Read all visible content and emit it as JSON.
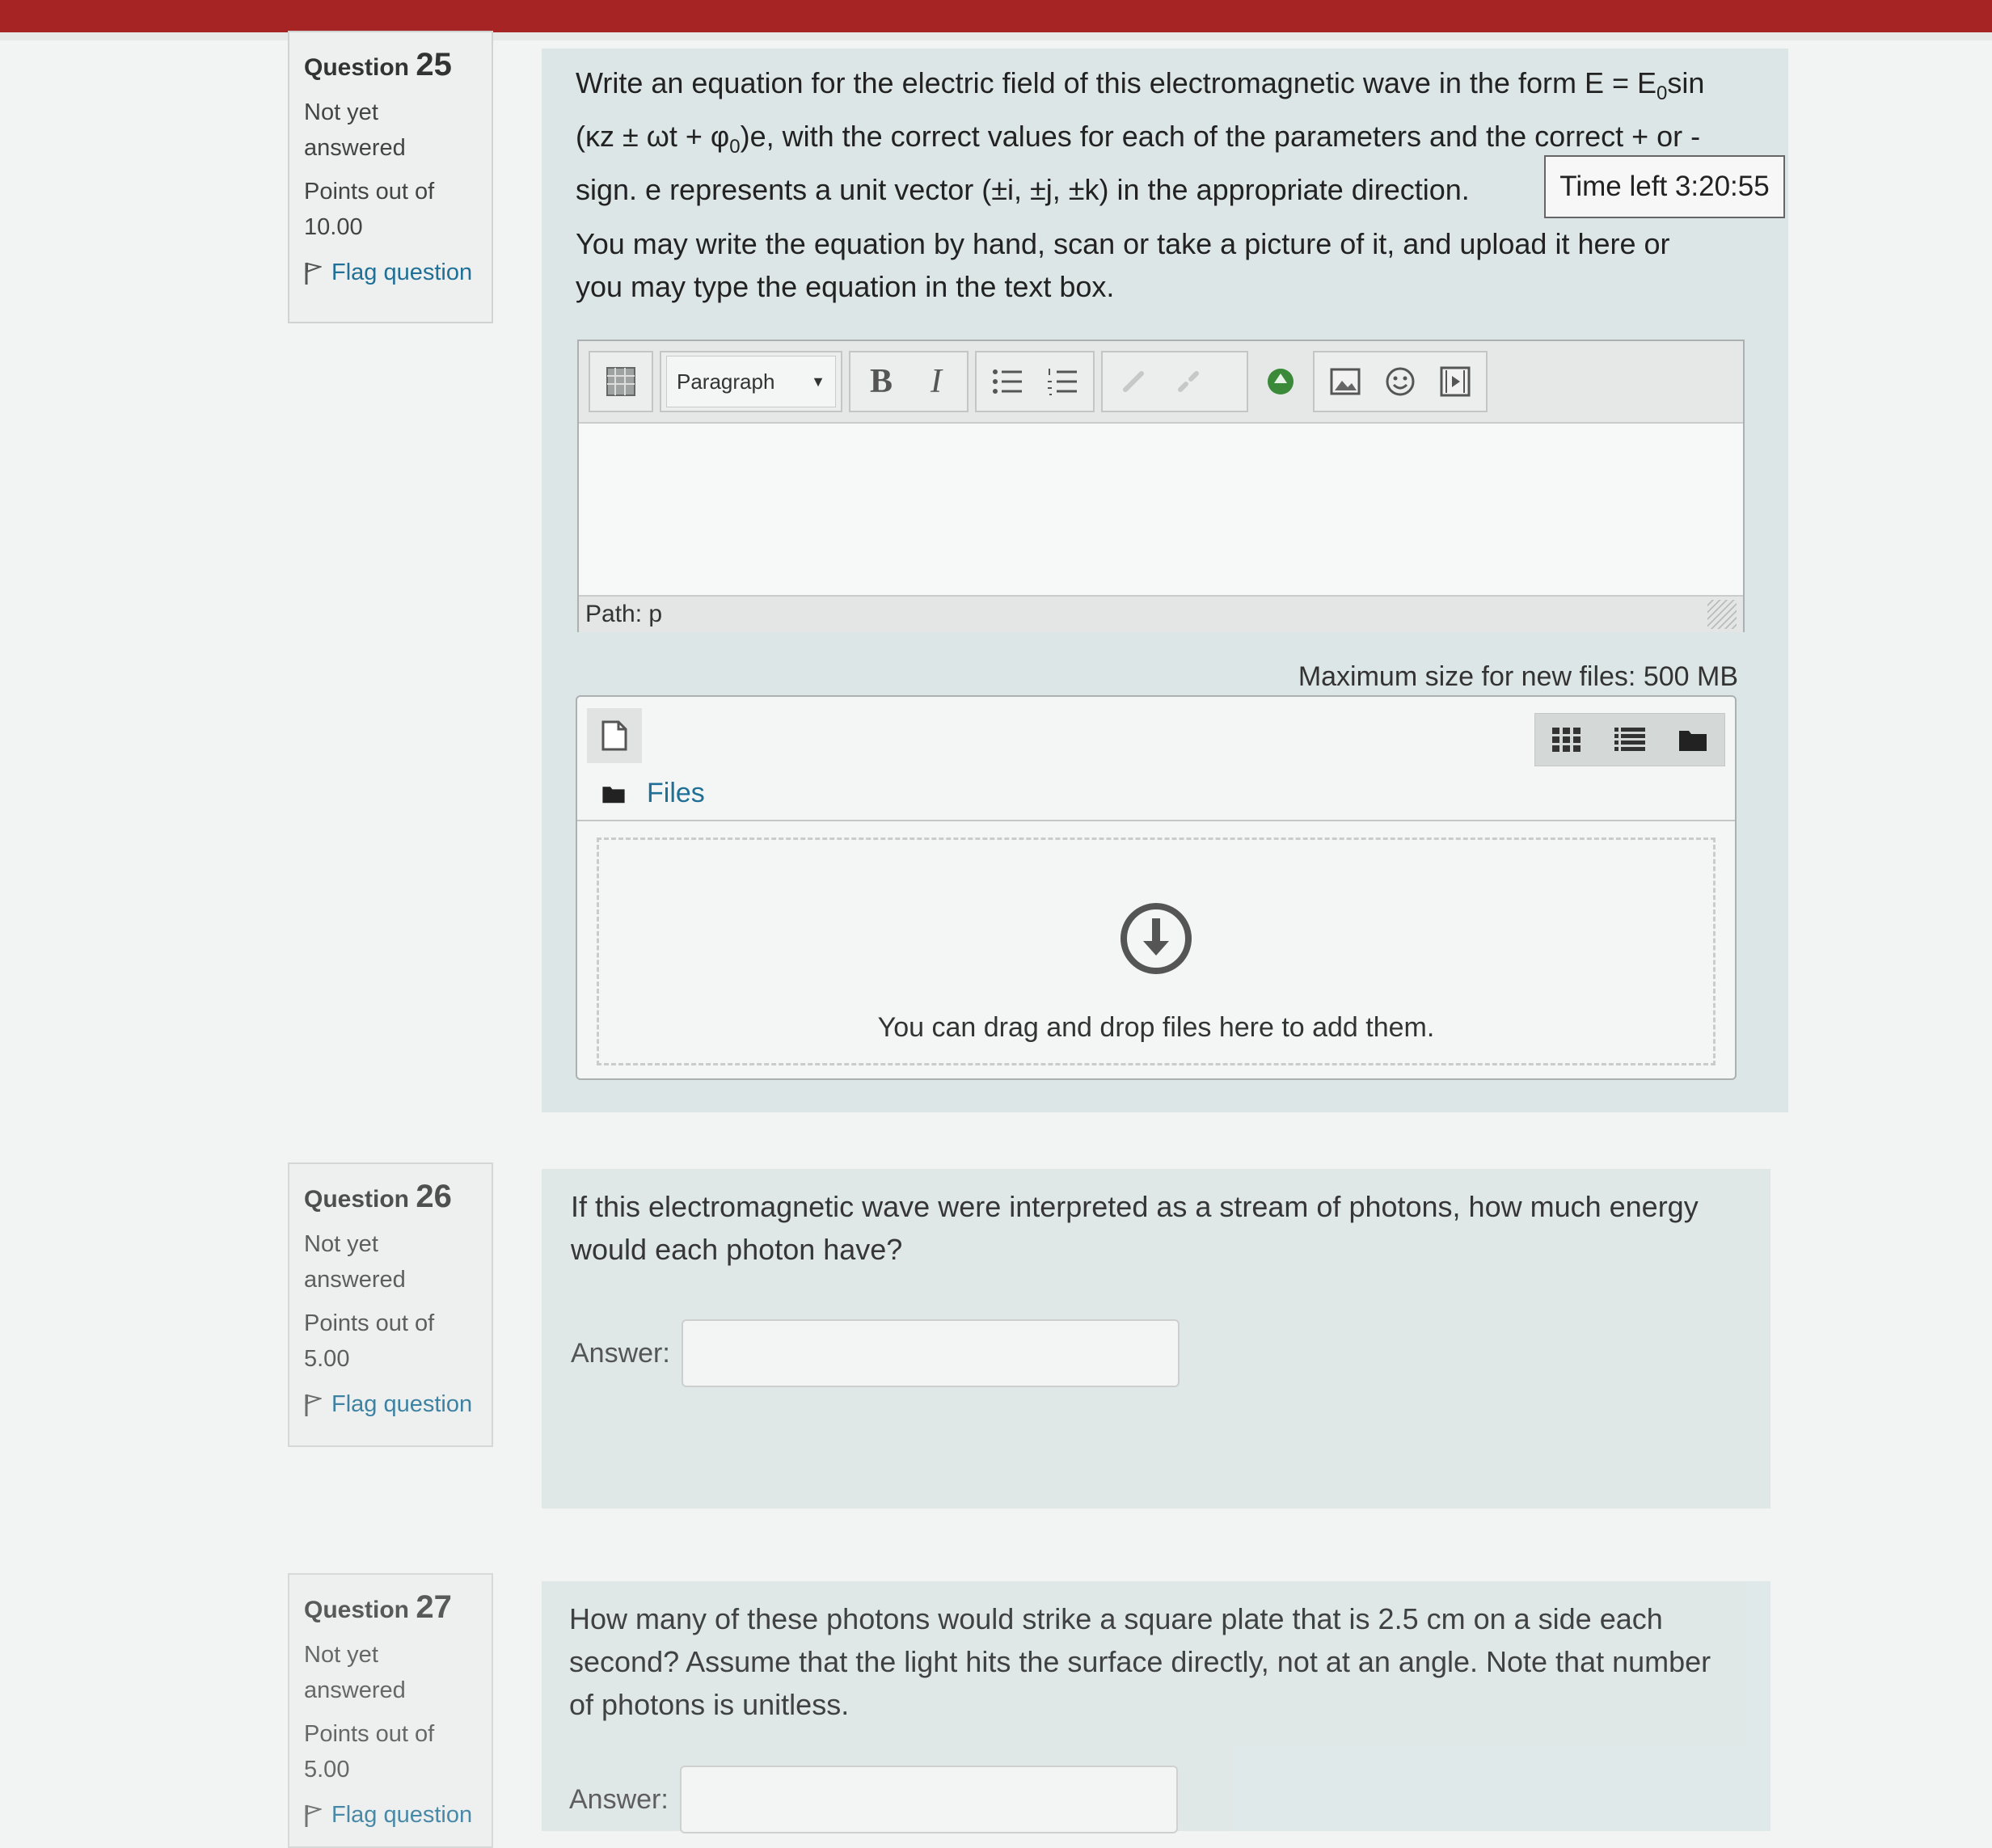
{
  "questions": [
    {
      "label": "Question",
      "number": "25",
      "state": "Not yet answered",
      "grade": "Points out of 10.00",
      "flag_label": "Flag question",
      "text_p1_a": "Write an equation for the electric field of this electromagnetic wave in the form E = E",
      "text_p1_sub_a": "0",
      "text_p1_b": "sin (κz ± ωt + φ",
      "text_p1_sub_b": "0",
      "text_p1_c": ")e, with the correct values for each of the parameters and the correct + or - sign. e represents a unit vector (±i, ±j, ±k) in the appropriate direction.",
      "text_p2": "You may write the equation by hand, scan or take a picture of it, and upload it here or you may type the equation in the text box."
    },
    {
      "label": "Question",
      "number": "26",
      "state": "Not yet answered",
      "grade": "Points out of 5.00",
      "flag_label": "Flag question",
      "text": "If this electromagnetic wave were interpreted as a stream of photons, how much energy would each photon have?",
      "answer_label": "Answer:",
      "answer_value": ""
    },
    {
      "label": "Question",
      "number": "27",
      "state": "Not yet answered",
      "grade": "Points out of 5.00",
      "flag_label": "Flag question",
      "text": "How many of these photons would strike a square plate that is 2.5 cm on a side each second? Assume that the light hits the surface directly, not at an angle. Note that number of photons is unitless.",
      "answer_label": "Answer:",
      "answer_value": ""
    }
  ],
  "timer": "Time left 3:20:55",
  "editor": {
    "format_select": "Paragraph",
    "bold": "B",
    "italic": "I",
    "path_label": "Path: p"
  },
  "filemanager": {
    "max_size": "Maximum size for new files: 500 MB",
    "files_link": "Files",
    "drop_message": "You can drag and drop files here to add them."
  },
  "colors": {
    "top_bar": "#a62424",
    "link": "#1f6f96",
    "content_bg": "#dde6e6"
  }
}
